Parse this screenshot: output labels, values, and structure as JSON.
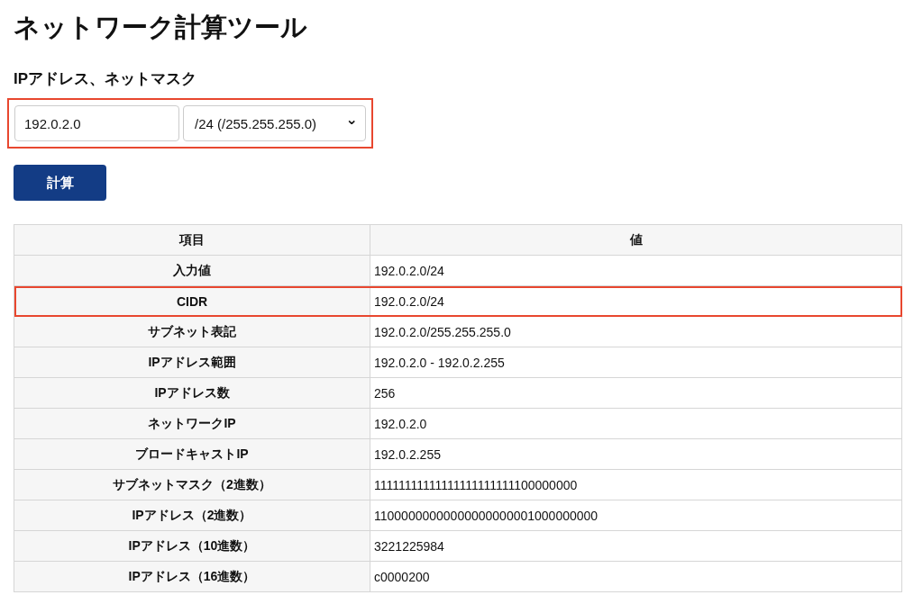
{
  "title": "ネットワーク計算ツール",
  "form": {
    "label": "IPアドレス、ネットマスク",
    "highlighted": true,
    "ip_field": {
      "value": "192.0.2.0"
    },
    "mask_select": {
      "value": "/24 (/255.255.255.0)"
    },
    "caret": "⌄"
  },
  "button": "計算",
  "table": {
    "columns": [
      "項目",
      "値"
    ],
    "rows": [
      {
        "item": "入力値",
        "value": "192.0.2.0/24",
        "highlighted": false
      },
      {
        "item": "CIDR",
        "value": "192.0.2.0/24",
        "highlighted": true
      },
      {
        "item": "サブネット表記",
        "value": "192.0.2.0/255.255.255.0",
        "highlighted": false
      },
      {
        "item": "IPアドレス範囲",
        "value": "192.0.2.0 - 192.0.2.255",
        "highlighted": false
      },
      {
        "item": "IPアドレス数",
        "value": "256",
        "highlighted": false
      },
      {
        "item": "ネットワークIP",
        "value": "192.0.2.0",
        "highlighted": false
      },
      {
        "item": "ブロードキャストIP",
        "value": "192.0.2.255",
        "highlighted": false
      },
      {
        "item": "サブネットマスク（2進数）",
        "value": "11111111111111111111111100000000",
        "highlighted": false
      },
      {
        "item": "IPアドレス（2進数）",
        "value": "11000000000000000000001000000000",
        "highlighted": false
      },
      {
        "item": "IPアドレス（10進数）",
        "value": "3221225984",
        "highlighted": false
      },
      {
        "item": "IPアドレス（16進数）",
        "value": "c0000200",
        "highlighted": false
      }
    ]
  }
}
